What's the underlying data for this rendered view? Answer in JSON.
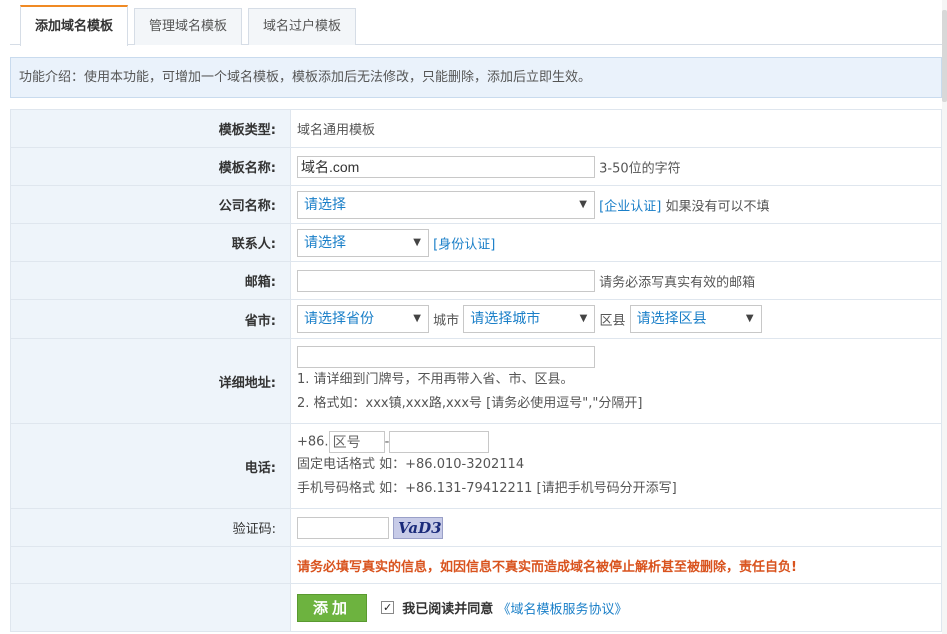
{
  "tabs": [
    {
      "label": "添加域名模板",
      "active": true
    },
    {
      "label": "管理域名模板",
      "active": false
    },
    {
      "label": "域名过户模板",
      "active": false
    }
  ],
  "notice": "功能介绍：使用本功能，可增加一个域名模板，模板添加后无法修改，只能删除，添加后立即生效。",
  "form": {
    "template_type": {
      "label": "模板类型:",
      "value": "域名通用模板"
    },
    "template_name": {
      "label": "模板名称:",
      "value": "域名.com",
      "hint": "3-50位的字符"
    },
    "company": {
      "label": "公司名称:",
      "select": "请选择",
      "link": "[企业认证]",
      "hint": "如果没有可以不填"
    },
    "contact": {
      "label": "联系人:",
      "select": "请选择",
      "link": "[身份认证]"
    },
    "email": {
      "label": "邮箱:",
      "value": "",
      "hint": "请务必添写真实有效的邮箱"
    },
    "region": {
      "label": "省市:",
      "province": "请选择省份",
      "city_label": "城市",
      "city": "请选择城市",
      "district_label": "区县",
      "district": "请选择区县"
    },
    "address": {
      "label": "详细地址:",
      "value": "",
      "note1": "1. 请详细到门牌号，不用再带入省、市、区县。",
      "note2": "2. 格式如：xxx镇,xxx路,xxx号 [请务必使用逗号\",\"分隔开]"
    },
    "phone": {
      "label": "电话:",
      "prefix": "+86.",
      "area_placeholder": "区号",
      "dash": "-",
      "note1": "固定电话格式 如：+86.010-3202114",
      "note2": "手机号码格式 如：+86.131-79412211 [请把手机号码分开添写]"
    },
    "captcha": {
      "label": "验证码:",
      "image_text": "VaD3"
    },
    "warning": "请务必填写真实的信息，如因信息不真实而造成域名被停止解析甚至被删除，责任自负!",
    "submit": {
      "button": "添加",
      "agree_text": "我已阅读并同意",
      "agreement_link": "《域名模板服务协议》",
      "checked": true
    }
  }
}
